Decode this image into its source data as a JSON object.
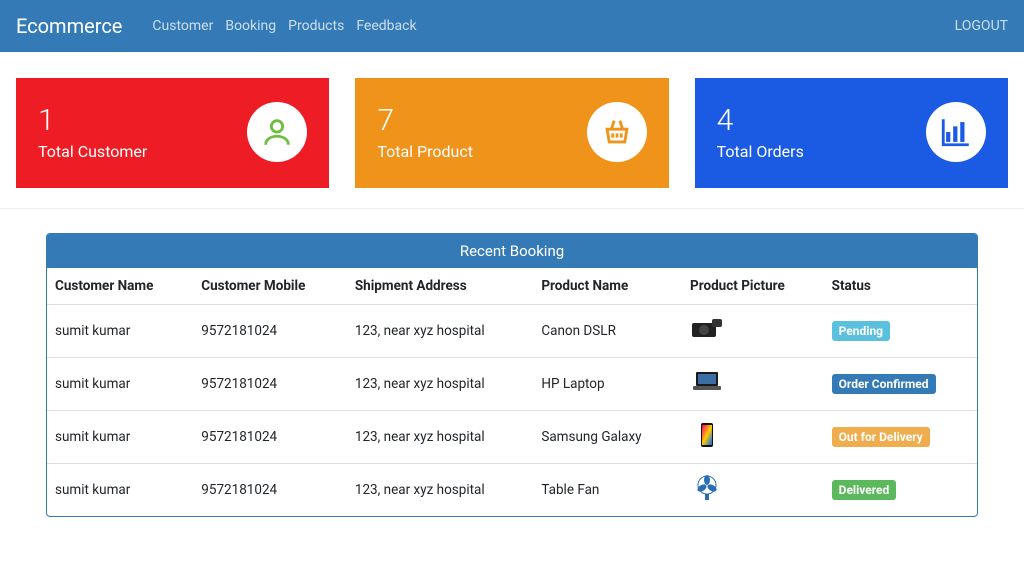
{
  "nav": {
    "brand": "Ecommerce",
    "links": [
      "Customer",
      "Booking",
      "Products",
      "Feedback"
    ],
    "logout": "LOGOUT"
  },
  "cards": {
    "customer": {
      "value": "1",
      "label": "Total Customer",
      "bg": "#ee1c25",
      "icon": "user-icon"
    },
    "product": {
      "value": "7",
      "label": "Total Product",
      "bg": "#f0931b",
      "icon": "basket-icon"
    },
    "orders": {
      "value": "4",
      "label": "Total Orders",
      "bg": "#1b5be3",
      "icon": "bar-chart-icon"
    }
  },
  "panel": {
    "title": "Recent Booking",
    "columns": [
      "Customer Name",
      "Customer Mobile",
      "Shipment Address",
      "Product Name",
      "Product Picture",
      "Status"
    ],
    "rows": [
      {
        "name": "sumit kumar",
        "mobile": "9572181024",
        "address": "123, near xyz hospital",
        "product": "Canon DSLR",
        "picture": "camera-icon",
        "status_label": "Pending",
        "status_class": "pending"
      },
      {
        "name": "sumit kumar",
        "mobile": "9572181024",
        "address": "123, near xyz hospital",
        "product": "HP Laptop",
        "picture": "laptop-icon",
        "status_label": "Order Confirmed",
        "status_class": "confirmed"
      },
      {
        "name": "sumit kumar",
        "mobile": "9572181024",
        "address": "123, near xyz hospital",
        "product": "Samsung Galaxy",
        "picture": "phone-icon",
        "status_label": "Out for Delivery",
        "status_class": "out"
      },
      {
        "name": "sumit kumar",
        "mobile": "9572181024",
        "address": "123, near xyz hospital",
        "product": "Table Fan",
        "picture": "fan-icon",
        "status_label": "Delivered",
        "status_class": "delivered"
      }
    ]
  }
}
